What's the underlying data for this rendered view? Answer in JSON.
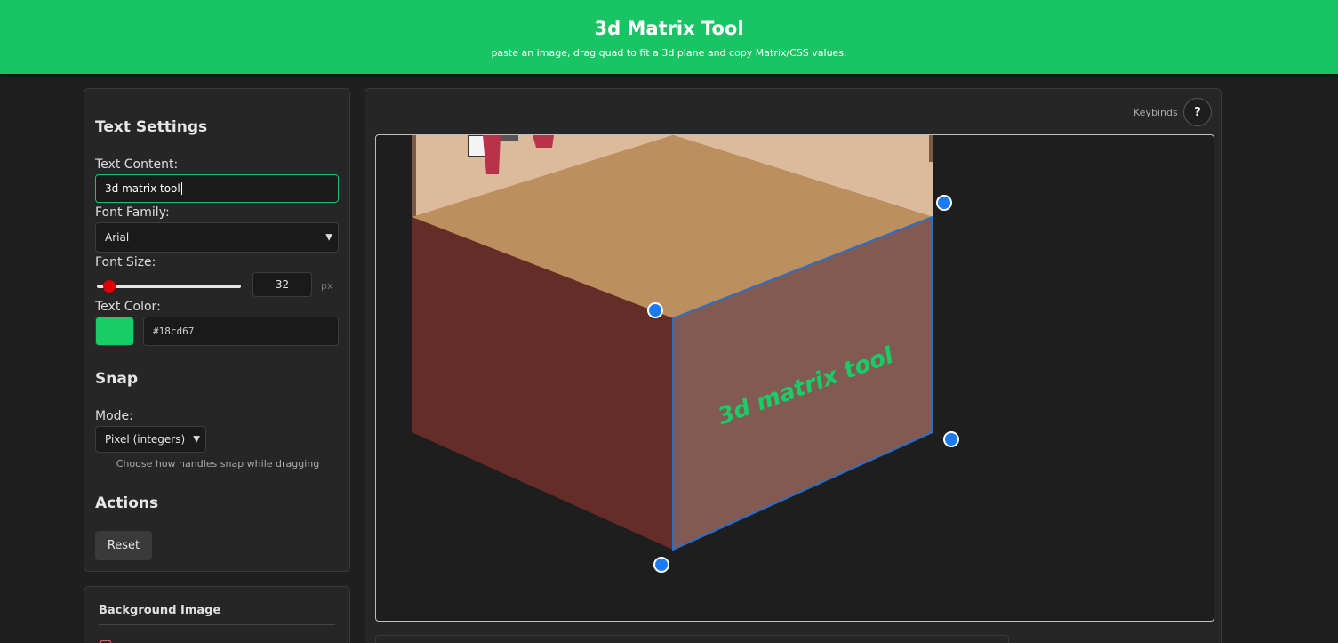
{
  "header": {
    "title": "3d Matrix Tool",
    "subtitle": "paste an image, drag quad to fit a 3d plane and copy Matrix/CSS values."
  },
  "text_settings": {
    "title": "Text Settings",
    "content_label": "Text Content:",
    "content_value": "3d matrix tool",
    "font_family_label": "Font Family:",
    "font_family_value": "Arial",
    "font_size_label": "Font Size:",
    "font_size_value": "32",
    "font_size_unit": "px",
    "font_size_slider_fraction": 0.05,
    "text_color_label": "Text Color:",
    "text_color_value": "#18cd67"
  },
  "snap": {
    "title": "Snap",
    "mode_label": "Mode:",
    "mode_value": "Pixel (integers)",
    "hint": "Choose how handles snap while dragging"
  },
  "actions": {
    "title": "Actions",
    "reset_label": "Reset"
  },
  "background_image": {
    "title": "Background Image"
  },
  "toolbar": {
    "keybinds_label": "Keybinds",
    "help_label": "?"
  },
  "canvas": {
    "overlay_text": "3d matrix tool",
    "handle_color": "#1a7cf5",
    "quad_outline_color": "#2a6fc6"
  },
  "colors": {
    "accent": "#19c464",
    "background": "#1f1f1f",
    "panel": "#262626"
  }
}
